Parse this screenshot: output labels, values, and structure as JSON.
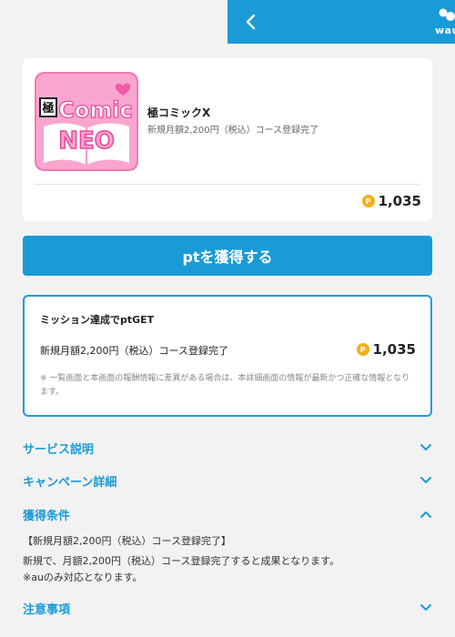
{
  "header": {
    "back_icon": "chevron-left-icon",
    "brand_text": "wau",
    "color": "#1a9bd7"
  },
  "app": {
    "title": "極コミックX",
    "subtitle": "新規月額2,200円（税込）コース登録完了",
    "thumbnail_text_top": "Comic",
    "thumbnail_text_bottom": "NEO",
    "thumbnail_badge": "極",
    "points": "1,035",
    "point_icon_letter": "P"
  },
  "cta": {
    "label": "ptを獲得する"
  },
  "mission": {
    "title": "ミッション達成でptGET",
    "task": "新規月額2,200円（税込）コース登録完了",
    "points": "1,035",
    "note": "※ 一覧画面と本画面の報酬情報に差異がある場合は、本詳細画面の情報が最新かつ正確な情報となります。"
  },
  "sections": [
    {
      "label": "サービス説明",
      "expanded": false
    },
    {
      "label": "キャンペーン詳細",
      "expanded": false
    },
    {
      "label": "獲得条件",
      "expanded": true
    },
    {
      "label": "注意事項",
      "expanded": false
    }
  ],
  "conditions": {
    "line1": "【新規月額2,200円（税込）コース登録完了】",
    "line2": "新規で、月額2,200円（税込）コース登録完了すると成果となります。",
    "line3": "※auのみ対応となります。"
  },
  "colors": {
    "accent": "#1a9bd7",
    "coin": "#f2b01e",
    "background": "#f2f2f2"
  }
}
